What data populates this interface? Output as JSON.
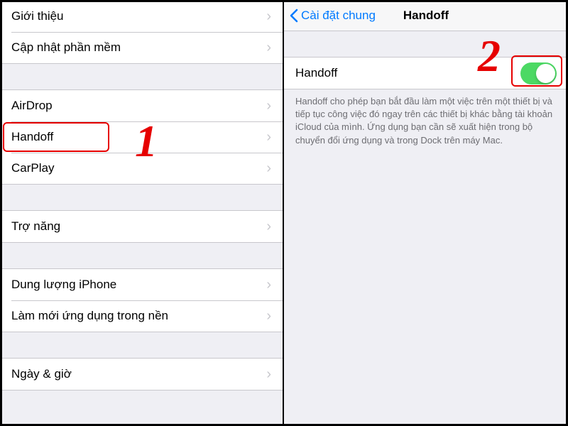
{
  "left": {
    "group1": [
      {
        "name": "row-about",
        "label": "Giới thiệu"
      },
      {
        "name": "row-software-update",
        "label": "Cập nhật phần mềm"
      }
    ],
    "group2": [
      {
        "name": "row-airdrop",
        "label": "AirDrop"
      },
      {
        "name": "row-handoff",
        "label": "Handoff"
      },
      {
        "name": "row-carplay",
        "label": "CarPlay"
      }
    ],
    "group3": [
      {
        "name": "row-accessibility",
        "label": "Trợ năng"
      }
    ],
    "group4": [
      {
        "name": "row-iphone-storage",
        "label": "Dung lượng iPhone"
      },
      {
        "name": "row-background-refresh",
        "label": "Làm mới ứng dụng trong nền"
      }
    ],
    "group5": [
      {
        "name": "row-date-time",
        "label": "Ngày & giờ"
      }
    ]
  },
  "right": {
    "back_label": "Cài đặt chung",
    "title": "Handoff",
    "toggle_row_label": "Handoff",
    "description": "Handoff cho phép bạn bắt đầu làm một việc trên một thiết bị và tiếp tục công việc đó ngay trên các thiết bị khác bằng tài khoản iCloud của mình. Ứng dụng bạn cần sẽ xuất hiện trong bộ chuyển đổi ứng dụng và trong Dock trên máy Mac."
  },
  "annotations": {
    "step1": "1",
    "step2": "2"
  },
  "colors": {
    "accent": "#007aff",
    "toggle_on": "#4cd964",
    "highlight": "#e60000"
  }
}
